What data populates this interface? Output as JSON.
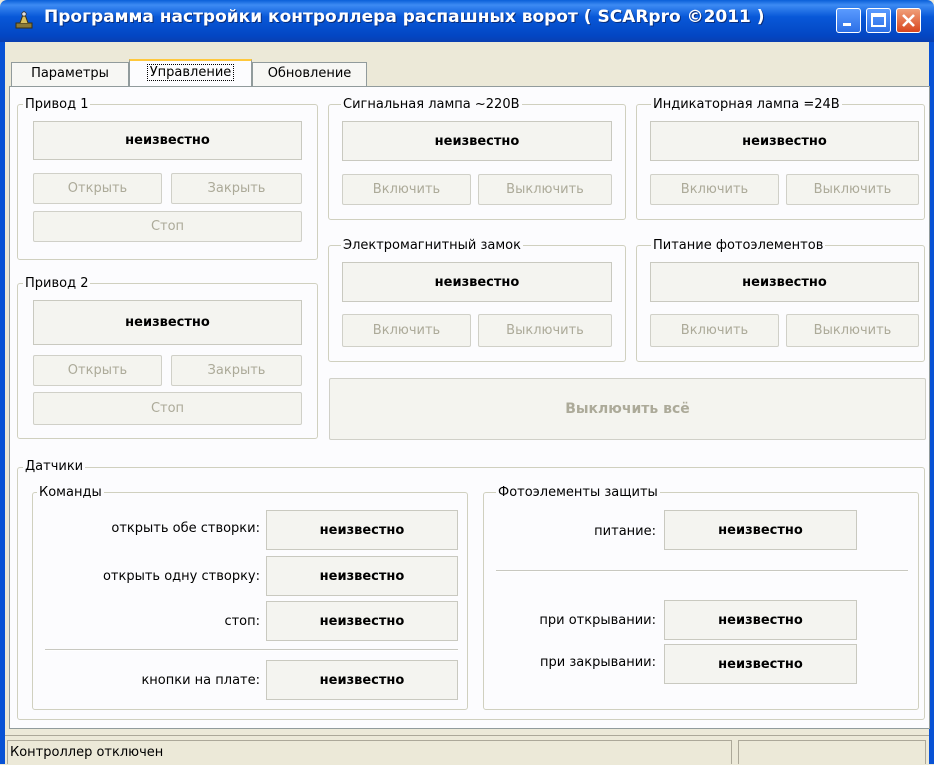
{
  "window": {
    "title": "Программа настройки контроллера распашных ворот ( SCARpro ©2011 )",
    "icon": "gate-controller-app-icon"
  },
  "tabs": [
    {
      "label": "Параметры",
      "active": false
    },
    {
      "label": "Управление",
      "active": true
    },
    {
      "label": "Обновление",
      "active": false
    }
  ],
  "drive1": {
    "title": "Привод 1",
    "status": "неизвестно",
    "open": "Открыть",
    "close": "Закрыть",
    "stop": "Стоп"
  },
  "drive2": {
    "title": "Привод 2",
    "status": "неизвестно",
    "open": "Открыть",
    "close": "Закрыть",
    "stop": "Стоп"
  },
  "signal_lamp": {
    "title": "Сигнальная лампа ~220В",
    "status": "неизвестно",
    "on": "Включить",
    "off": "Выключить"
  },
  "indicator_lamp": {
    "title": "Индикаторная лампа =24В",
    "status": "неизвестно",
    "on": "Включить",
    "off": "Выключить"
  },
  "em_lock": {
    "title": "Электромагнитный замок",
    "status": "неизвестно",
    "on": "Включить",
    "off": "Выключить"
  },
  "photo_power": {
    "title": "Питание фотоэлементов",
    "status": "неизвестно",
    "on": "Включить",
    "off": "Выключить"
  },
  "all_off": "Выключить всё",
  "sensors": {
    "title": "Датчики",
    "commands": {
      "title": "Команды",
      "rows": [
        {
          "label": "открыть обе створки:",
          "value": "неизвестно"
        },
        {
          "label": "открыть одну створку:",
          "value": "неизвестно"
        },
        {
          "label": "стоп:",
          "value": "неизвестно"
        },
        {
          "label": "кнопки на плате:",
          "value": "неизвестно"
        }
      ]
    },
    "photocells": {
      "title": "Фотоэлементы защиты",
      "power_label": "питание:",
      "power_value": "неизвестно",
      "opening_label": "при открывании:",
      "opening_value": "неизвестно",
      "closing_label": "при закрывании:",
      "closing_value": "неизвестно"
    }
  },
  "statusbar": {
    "message": "Контроллер отключен",
    "right": ""
  },
  "colors": {
    "titlebar": "#0a4fd0",
    "face": "#ece9d8",
    "panel": "#fcfcfe",
    "disabled_text": "#acaa99",
    "close_button": "#d9461e",
    "tab_highlight": "#ffc83c"
  }
}
